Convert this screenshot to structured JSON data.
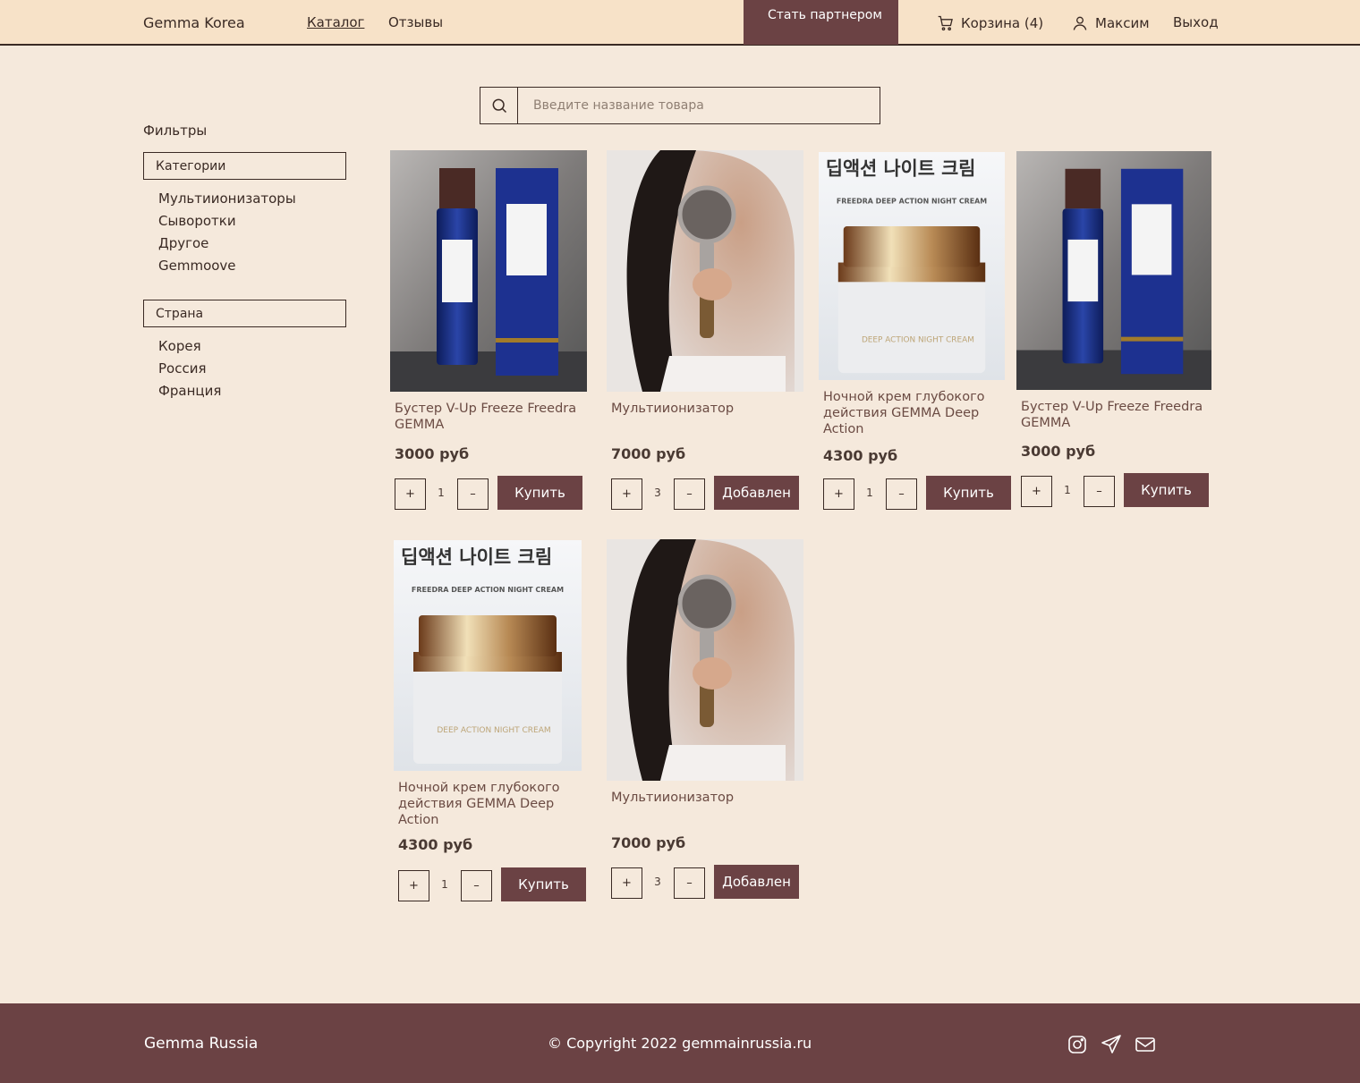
{
  "header": {
    "brand": "Gemma Korea",
    "nav": [
      "Каталог",
      "Отзывы"
    ],
    "partner_button": "Стать партнером",
    "cart": "Корзина (4)",
    "user": "Максим",
    "logout": "Выход"
  },
  "search": {
    "placeholder": "Введите название товара",
    "value": ""
  },
  "filters": {
    "title": "Фильтры",
    "categories_label": "Категории",
    "categories": [
      "Мультиионизаторы",
      "Сыворотки",
      "Другое",
      "Gemmoove"
    ],
    "country_label": "Страна",
    "countries": [
      "Корея",
      "Россия",
      "Франция"
    ]
  },
  "products": [
    {
      "image": "serum-bottle-image",
      "name": "Бустер V-Up Freeze Freedra GEMMA",
      "price": "3000 руб",
      "qty": "1",
      "action": "Купить",
      "plus": "+",
      "minus": "–"
    },
    {
      "image": "shower-head-woman-image",
      "name": "Мультиионизатор",
      "price": "7000 руб",
      "qty": "3",
      "action": "Добавлен",
      "plus": "+",
      "minus": "–"
    },
    {
      "image": "night-cream-jar-image",
      "name": "Ночной крем глубокого действия GEMMA Deep Action",
      "price": "4300 руб",
      "qty": "1",
      "action": "Купить",
      "plus": "+",
      "minus": "–",
      "image_text_ko": "딥액션 나이트 크림",
      "image_text_en": "FREEDRA DEEP ACTION NIGHT CREAM",
      "jar_label": "DEEP ACTION NIGHT CREAM"
    },
    {
      "image": "serum-bottle-image",
      "name": "Бустер V-Up Freeze Freedra GEMMA",
      "price": "3000 руб",
      "qty": "1",
      "action": "Купить",
      "plus": "+",
      "minus": "–"
    },
    {
      "image": "night-cream-jar-image",
      "name": "Ночной крем глубокого действия GEMMA Deep Action",
      "price": "4300 руб",
      "qty": "1",
      "action": "Купить",
      "plus": "+",
      "minus": "–",
      "image_text_ko": "딥액션 나이트 크림",
      "image_text_en": "FREEDRA DEEP ACTION NIGHT CREAM",
      "jar_label": "DEEP ACTION NIGHT CREAM"
    },
    {
      "image": "shower-head-woman-image",
      "name": "Мультиионизатор",
      "price": "7000 руб",
      "qty": "3",
      "action": "Добавлен",
      "plus": "+",
      "minus": "–"
    }
  ],
  "footer": {
    "brand": "Gemma Russia",
    "copyright": "© Copyright 2022 gemmainrussia.ru",
    "icons": [
      "instagram-icon",
      "telegram-icon",
      "mail-icon"
    ]
  },
  "colors": {
    "header_bg": "#f7e2c8",
    "page_bg": "#f5e9dc",
    "accent": "#6b4244"
  }
}
